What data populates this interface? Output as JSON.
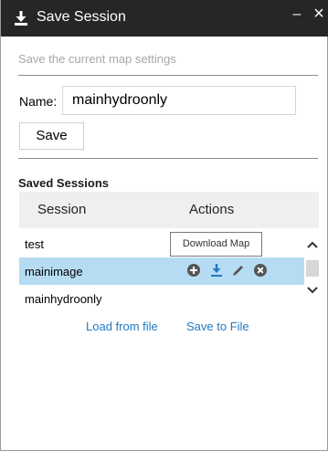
{
  "window": {
    "title": "Save Session",
    "title_icon": "download-icon",
    "minimize_icon": "minimize-icon",
    "close_icon": "close-icon",
    "minimize_label": "–",
    "close_label": "×"
  },
  "form": {
    "subtitle": "Save the current map settings",
    "name_label": "Name:",
    "name_value": "mainhydroonly",
    "save_label": "Save"
  },
  "saved": {
    "title": "Saved Sessions",
    "columns": [
      "Session",
      "Actions"
    ],
    "rows": [
      {
        "name": "test",
        "selected": false
      },
      {
        "name": "mainimage",
        "selected": true
      },
      {
        "name": "mainhydroonly",
        "selected": false
      }
    ],
    "action_icons": [
      "add-circle-icon",
      "download-icon",
      "edit-pencil-icon",
      "delete-circle-icon"
    ],
    "tooltip": "Download Map"
  },
  "links": {
    "load": "Load from file",
    "save": "Save to File"
  },
  "colors": {
    "titlebar": "#262626",
    "selected_row": "#b6dcf4",
    "accent": "#1f7ac4",
    "icon_gray": "#555555"
  }
}
